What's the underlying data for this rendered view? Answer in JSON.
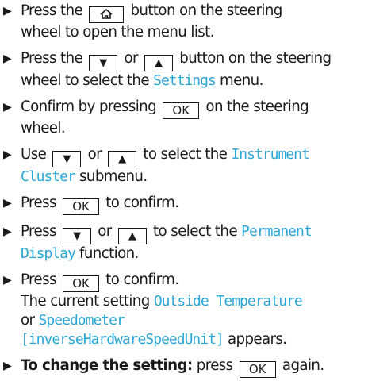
{
  "steps": [
    {
      "pre": "Press the",
      "post_line1": "button on the steering",
      "line2": "wheel to open the menu list."
    },
    {
      "pre": "Press the",
      "or": "or",
      "post_line1": "button on the steering",
      "line2_pre": "wheel to select the",
      "ui": "Settings",
      "line2_post": "menu."
    },
    {
      "pre": "Confirm by pressing",
      "post_line1": "on the steering",
      "line2": "wheel."
    },
    {
      "pre": "Use",
      "or": "or",
      "post_line1": "to select the",
      "ui_line1": "Instrument",
      "ui_line2": "Cluster",
      "line2_post": "submenu."
    },
    {
      "pre": "Press",
      "post": "to confirm."
    },
    {
      "pre": "Press",
      "or": "or",
      "post_line1": "to select the",
      "ui_line1": "Permanent",
      "ui_line2": "Display",
      "line2_post": "function."
    },
    {
      "pre": "Press",
      "post": "to confirm.",
      "line2_pre": "The current setting",
      "ui_a": "Outside Temperature",
      "line3_pre": "or",
      "ui_b": "Speedometer",
      "ui_c": "[inverseHardwareSpeedUnit]",
      "line4_post": "appears."
    },
    {
      "bold": "To change the setting:",
      "pre": "press",
      "post": "again."
    }
  ],
  "keys": {
    "ok": "OK",
    "down": "▼",
    "up": "▲",
    "home_icon": "home-icon"
  },
  "colors": {
    "text": "#1a1a1a",
    "ui_term": "#2aa7d6"
  }
}
